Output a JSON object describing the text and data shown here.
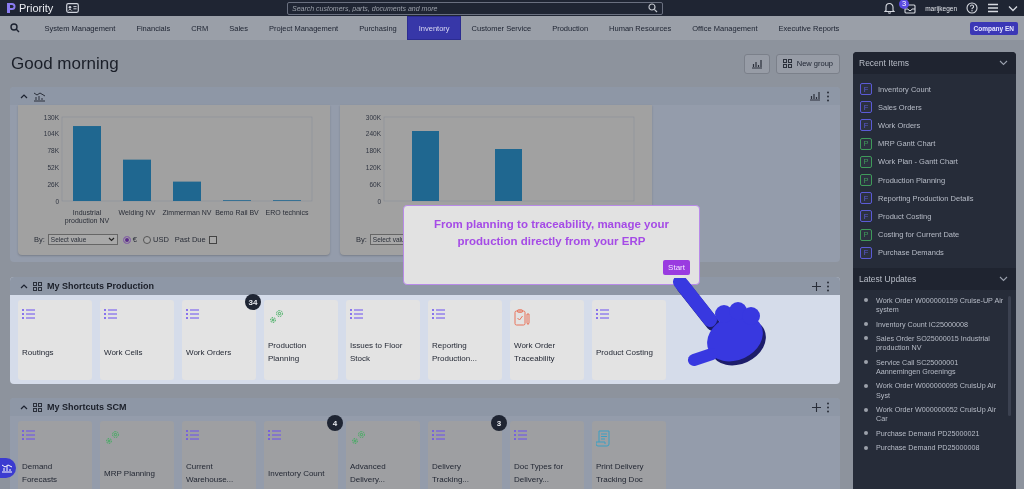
{
  "topbar": {
    "logo": "Priority",
    "search": {
      "placeholder": "Search customers, parts, documents and more"
    },
    "notifications_badge": "3",
    "user": "marijkegen"
  },
  "nav": {
    "items": [
      {
        "label": "System Management",
        "selected": false
      },
      {
        "label": "Financials",
        "selected": false
      },
      {
        "label": "CRM",
        "selected": false
      },
      {
        "label": "Sales",
        "selected": false
      },
      {
        "label": "Project Management",
        "selected": false
      },
      {
        "label": "Purchasing",
        "selected": false
      },
      {
        "label": "Inventory",
        "selected": true
      },
      {
        "label": "Customer Service",
        "selected": false
      },
      {
        "label": "Production",
        "selected": false
      },
      {
        "label": "Human Resources",
        "selected": false
      },
      {
        "label": "Office Management",
        "selected": false
      },
      {
        "label": "Executive Reports",
        "selected": false
      }
    ],
    "company": "Company EN"
  },
  "greeting": "Good morning",
  "new_group": "New group",
  "charts_panel": {
    "cards": [
      {
        "chart_data": {
          "type": "bar",
          "categories": [
            "Industrial production NV",
            "Welding NV",
            "Zimmerman NV",
            "Bemo Rail BV",
            "ERO technics"
          ],
          "values": [
            116000,
            64000,
            30000,
            0,
            0
          ],
          "ylim": [
            0,
            130000
          ],
          "yticks": [
            {
              "value": 0,
              "label": "0"
            },
            {
              "value": 26000,
              "label": "26K"
            },
            {
              "value": 52000,
              "label": "52K"
            },
            {
              "value": 78000,
              "label": "78K"
            },
            {
              "value": 104000,
              "label": "104K"
            },
            {
              "value": 130000,
              "label": "130K"
            }
          ]
        },
        "filter": {
          "by_label": "By:",
          "select": "Select value",
          "currency": [
            {
              "label": "€",
              "selected": true
            },
            {
              "label": "USD",
              "selected": false
            }
          ],
          "past_due": {
            "label": "Past Due",
            "checked": false
          }
        }
      },
      {
        "axis_labels": [
          "300K",
          "240K",
          "180K",
          "120K",
          "60K",
          "0"
        ],
        "filter": {
          "by_label": "By:",
          "select": "Select valu"
        }
      }
    ]
  },
  "tour": {
    "message": "From planning to traceability, manage your production directly from your ERP",
    "button": "Start"
  },
  "shortcut_groups": [
    {
      "title": "My Shortcuts Production",
      "highlighted": true,
      "tiles": [
        {
          "label": "Routings",
          "kind": "list"
        },
        {
          "label": "Work Cells",
          "kind": "list"
        },
        {
          "label": "Work Orders",
          "kind": "list",
          "badge": "34"
        },
        {
          "label": "Production Planning",
          "kind": "gears"
        },
        {
          "label": "Issues to Floor Stock",
          "kind": "list"
        },
        {
          "label": "Reporting Production...",
          "kind": "list"
        },
        {
          "label": "Work Order Traceability",
          "kind": "clipboard"
        },
        {
          "label": "Product Costing",
          "kind": "list"
        }
      ]
    },
    {
      "title": "My Shortcuts SCM",
      "highlighted": false,
      "tiles": [
        {
          "label": "Demand Forecasts",
          "kind": "list"
        },
        {
          "label": "MRP Planning",
          "kind": "gears"
        },
        {
          "label": "Current Warehouse...",
          "kind": "list"
        },
        {
          "label": "Inventory Count",
          "kind": "list",
          "badge": "4"
        },
        {
          "label": "Advanced Delivery...",
          "kind": "gears"
        },
        {
          "label": "Delivery Tracking...",
          "kind": "list",
          "badge": "3"
        },
        {
          "label": "Doc Types for Delivery...",
          "kind": "list"
        },
        {
          "label": "Print Delivery Tracking Doc",
          "kind": "scroll"
        }
      ]
    }
  ],
  "recent_items": {
    "title": "Recent Items",
    "items": [
      {
        "badge": "F",
        "color": "#5b5bd6",
        "label": "Inventory Count"
      },
      {
        "badge": "F",
        "color": "#5b5bd6",
        "label": "Sales Orders"
      },
      {
        "badge": "F",
        "color": "#5b5bd6",
        "label": "Work Orders"
      },
      {
        "badge": "P",
        "color": "#3f9a5a",
        "label": "MRP Gantt Chart"
      },
      {
        "badge": "P",
        "color": "#3f9a5a",
        "label": "Work Plan - Gantt Chart"
      },
      {
        "badge": "P",
        "color": "#3f9a5a",
        "label": "Production Planning"
      },
      {
        "badge": "F",
        "color": "#5b5bd6",
        "label": "Reporting Production Details"
      },
      {
        "badge": "F",
        "color": "#5b5bd6",
        "label": "Product Costing"
      },
      {
        "badge": "P",
        "color": "#3f9a5a",
        "label": "Costing for Current Date"
      },
      {
        "badge": "F",
        "color": "#5b5bd6",
        "label": "Purchase Demands"
      }
    ]
  },
  "latest_updates": {
    "title": "Latest Updates",
    "items": [
      "Work Order W000000159 Cruise-UP Air system",
      "Inventory Count IC25000008",
      "Sales Order SO25000015 Industrial production NV",
      "Service Call SC25000001 Aannemingen Groenings",
      "Work Order W000000095 CruisUp Air Syst",
      "Work Order W000000052 CruisUp Air Car",
      "Purchase Demand PD25000021",
      "Purchase Demand PD25000008"
    ]
  }
}
